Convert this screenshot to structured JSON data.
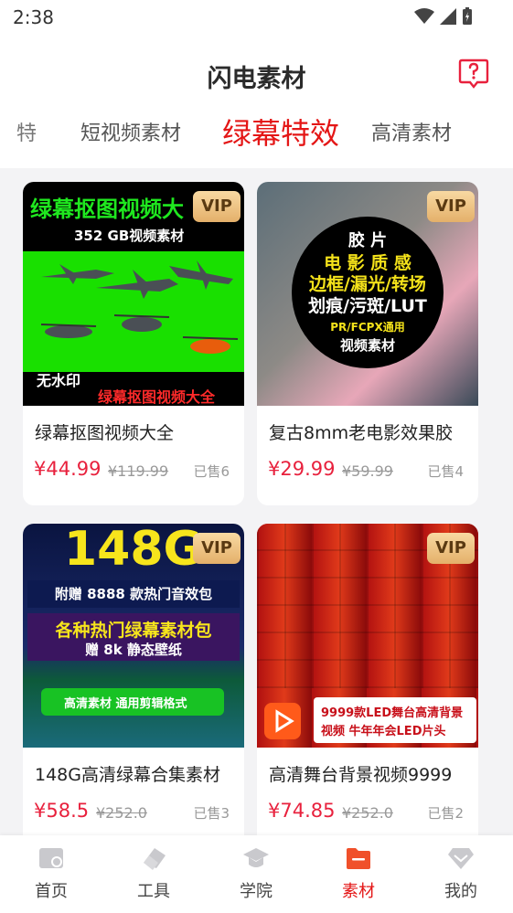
{
  "status_bar": {
    "time": "2:38"
  },
  "header": {
    "title": "闪电素材",
    "help_icon": "help-question-icon"
  },
  "tabs": [
    {
      "label": "特",
      "active": false
    },
    {
      "label": "短视频素材",
      "active": false
    },
    {
      "label": "绿幕特效",
      "active": true
    },
    {
      "label": "高清素材",
      "active": false
    }
  ],
  "products": [
    {
      "vip": "VIP",
      "name": "绿幕抠图视频大全",
      "price": "¥44.99",
      "original_price": "¥119.99",
      "sold": "已售6",
      "thumb_texts": [
        "绿幕抠图视频大",
        "352 GB视频素材",
        "无水印",
        "绿幕抠图视频大全"
      ]
    },
    {
      "vip": "VIP",
      "name": "复古8mm老电影效果胶",
      "price": "¥29.99",
      "original_price": "¥59.99",
      "sold": "已售4",
      "thumb_texts": [
        "胶 片",
        "电 影 质 感",
        "边框/漏光/转场",
        "划痕/污斑/LUT",
        "PR/FCPX通用",
        "视频素材"
      ]
    },
    {
      "vip": "VIP",
      "name": "148G高清绿幕合集素材",
      "price": "¥58.5",
      "original_price": "¥252.0",
      "sold": "已售3",
      "thumb_texts": [
        "148G",
        "附赠 8888 款热门音效包",
        "各种热门绿幕素材包",
        "赠 8k 静态壁纸",
        "高清素材  通用剪辑格式"
      ]
    },
    {
      "vip": "VIP",
      "name": "高清舞台背景视频9999",
      "price": "¥74.85",
      "original_price": "¥252.0",
      "sold": "已售2",
      "thumb_texts": [
        "9999款LED舞台高清背景",
        "视频   牛年年会LED片头"
      ]
    }
  ],
  "bottom_nav": [
    {
      "label": "首页",
      "icon": "home-icon",
      "active": false
    },
    {
      "label": "工具",
      "icon": "eraser-tool-icon",
      "active": false
    },
    {
      "label": "学院",
      "icon": "graduation-cap-icon",
      "active": false
    },
    {
      "label": "素材",
      "icon": "folder-icon",
      "active": true
    },
    {
      "label": "我的",
      "icon": "diamond-icon",
      "active": false
    }
  ],
  "colors": {
    "accent": "#e41616",
    "price": "#e8213d",
    "vip_gold": "#e4b06a"
  }
}
